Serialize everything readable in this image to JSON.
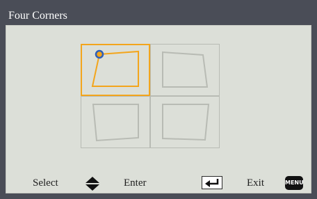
{
  "window": {
    "title": "Four Corners"
  },
  "corners": {
    "top_left": {
      "name": "top-left",
      "selected": true
    },
    "top_right": {
      "name": "top-right",
      "selected": false
    },
    "bottom_left": {
      "name": "bottom-left",
      "selected": false
    },
    "bottom_right": {
      "name": "bottom-right",
      "selected": false
    }
  },
  "footer": {
    "select_label": "Select",
    "select_icon": "up-down-arrows-icon",
    "enter_label": "Enter",
    "enter_icon": "enter-key-icon",
    "exit_label": "Exit",
    "exit_icon_text": "MENU"
  },
  "colors": {
    "highlight": "#f3a51c",
    "handle": "#2f5fb8",
    "inactive_shape": "#b8bbb4",
    "panel": "#dcdfd8",
    "frame": "#4a4d57"
  }
}
